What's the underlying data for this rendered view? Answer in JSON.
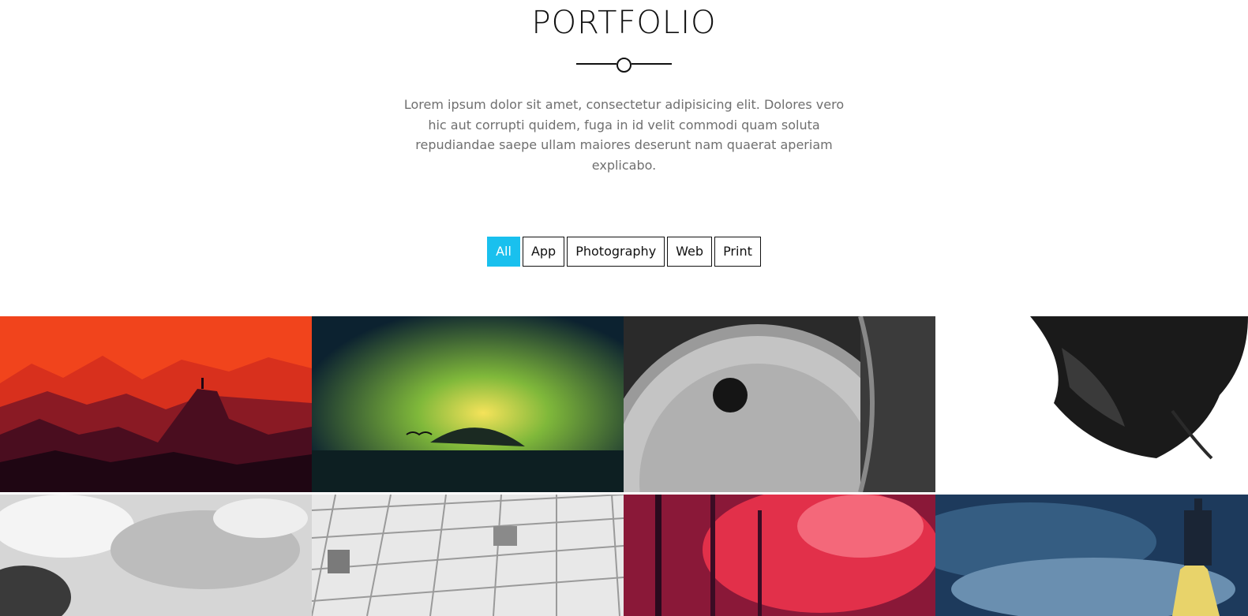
{
  "section": {
    "title": "PORTFOLIO",
    "description": "Lorem ipsum dolor sit amet, consectetur adipisicing elit. Dolores vero hic aut corrupti quidem, fuga in id velit commodi quam soluta repudiandae saepe ullam maiores deserunt nam quaerat aperiam explicabo."
  },
  "filters": [
    {
      "label": "All",
      "active": true
    },
    {
      "label": "App",
      "active": false
    },
    {
      "label": "Photography",
      "active": false
    },
    {
      "label": "Web",
      "active": false
    },
    {
      "label": "Print",
      "active": false
    }
  ],
  "portfolio_items": [
    {
      "name": "mountain-sunset"
    },
    {
      "name": "fantasy-ocean-storm"
    },
    {
      "name": "vintage-clock"
    },
    {
      "name": "ink-in-water"
    },
    {
      "name": "grey-smoke"
    },
    {
      "name": "white-cubes"
    },
    {
      "name": "red-forest"
    },
    {
      "name": "castle-on-cliff"
    }
  ],
  "colors": {
    "accent": "#19c0ee",
    "text": "#111111",
    "muted_text": "#6f6f6f"
  }
}
